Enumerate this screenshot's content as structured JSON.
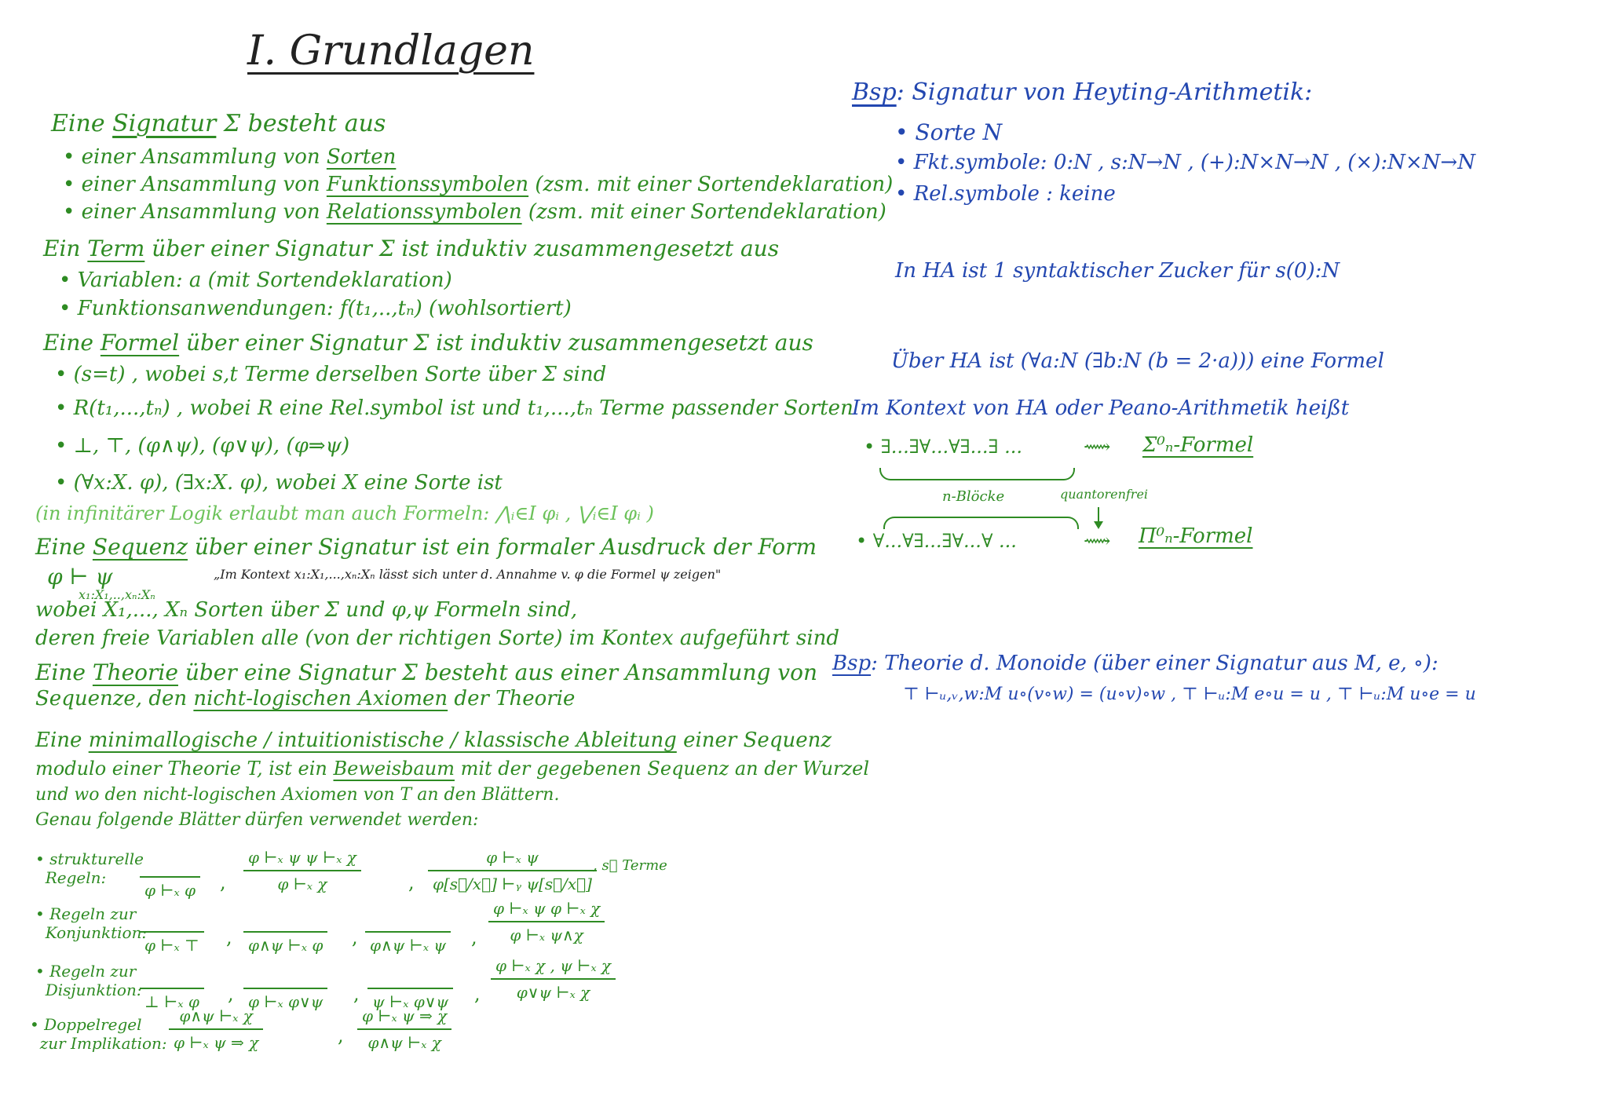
{
  "title": "I. Grundlagen",
  "left": {
    "signatur_intro": {
      "pre": "Eine ",
      "term": "Signatur",
      "post": " Σ besteht aus"
    },
    "signatur_items": [
      {
        "pre": "• einer Ansammlung von ",
        "term": "Sorten",
        "post": ""
      },
      {
        "pre": "• einer Ansammlung von ",
        "term": "Funktionssymbolen",
        "post": " (zsm. mit einer Sortendeklaration)"
      },
      {
        "pre": "• einer Ansammlung von ",
        "term": "Relationssymbolen",
        "post": " (zsm. mit einer Sortendeklaration)"
      }
    ],
    "term_intro": {
      "pre": "Ein ",
      "term": "Term",
      "post": " über einer Signatur Σ ist induktiv zusammengesetzt aus"
    },
    "term_items": [
      "• Variablen: a   (mit Sortendeklaration)",
      "• Funktionsanwendungen: f(t₁,..,tₙ)   (wohlsortiert)"
    ],
    "formel_intro": {
      "pre": "Eine ",
      "term": "Formel",
      "post": " über einer Signatur Σ ist induktiv zusammengesetzt aus"
    },
    "formel_items": [
      "• (s=t)  , wobei  s,t  Terme derselben Sorte über Σ sind",
      "• R(t₁,...,tₙ) , wobei R eine Rel.symbol ist und t₁,...,tₙ Terme passender Sorten",
      "• ⊥, ⊤, (φ∧ψ), (φ∨ψ), (φ⇒ψ)",
      "• (∀x:X. φ), (∃x:X. φ), wobei X eine Sorte ist"
    ],
    "infinitary_note": "(in infinitärer Logik erlaubt man auch Formeln: ⋀ᵢ∈I φᵢ , ⋁ᵢ∈I φᵢ )",
    "sequenz_intro": {
      "pre": "Eine ",
      "term": "Sequenz",
      "post": " über einer Signatur ist ein formaler Ausdruck der Form"
    },
    "sequenz_form": "φ ⊢ ψ",
    "sequenz_subscript": "x₁:X₁,..,xₙ:Xₙ",
    "sequenz_reading": "„Im Kontext x₁:X₁,...,xₙ:Xₙ lässt sich unter d. Annahme v. φ die Formel ψ zeigen\"",
    "sequenz_where": [
      "wobei X₁,..., Xₙ Sorten über Σ und φ,ψ Formeln sind,",
      "deren freie Variablen alle (von der richtigen Sorte) im Kontex aufgeführt sind"
    ],
    "theorie_intro": {
      "pre": "Eine ",
      "term": "Theorie",
      "post": " über eine Signatur Σ besteht aus einer Ansammlung von"
    },
    "theorie_line2": {
      "pre": "Sequenze, den ",
      "term": "nicht-logischen Axiomen",
      "post": " der Theorie"
    },
    "ableitung_line1": {
      "pre": "Eine ",
      "term": "minimallogische / intuitionistische / klassische Ableitung",
      "post": " einer Sequenz"
    },
    "ableitung_line2": {
      "pre": "modulo einer Theorie T, ist ein ",
      "term": "Beweisbaum",
      "post": " mit der gegebenen Sequenz an der Wurzel"
    },
    "ableitung_line3": "und wo den nicht-logischen Axiomen von T an den Blättern.",
    "ableitung_line4": "Genau folgende Blätter dürfen verwendet werden:",
    "rules": {
      "struct_label": "• strukturelle\n  Regeln:",
      "struct": [
        {
          "num": "",
          "den": "φ ⊢ₓ φ"
        },
        {
          "num": "φ ⊢ₓ ψ    ψ ⊢ₓ χ",
          "den": "φ ⊢ₓ χ"
        },
        {
          "num": "φ ⊢ₓ ψ",
          "den": "φ[s⃗/x⃗] ⊢ᵧ ψ[s⃗/x⃗]"
        }
      ],
      "struct_note": ", s⃗ Terme",
      "konj_label": "• Regeln zur\n  Konjunktion:",
      "konj": [
        {
          "num": "",
          "den": "φ ⊢ₓ ⊤"
        },
        {
          "num": "",
          "den": "φ∧ψ ⊢ₓ φ"
        },
        {
          "num": "",
          "den": "φ∧ψ ⊢ₓ ψ"
        },
        {
          "num": "φ ⊢ₓ ψ    φ ⊢ₓ χ",
          "den": "φ ⊢ₓ ψ∧χ"
        }
      ],
      "disj_label": "• Regeln zur\n  Disjunktion:",
      "disj": [
        {
          "num": "",
          "den": "⊥ ⊢ₓ φ"
        },
        {
          "num": "",
          "den": "φ ⊢ₓ φ∨ψ"
        },
        {
          "num": "",
          "den": "ψ ⊢ₓ φ∨ψ"
        },
        {
          "num": "φ ⊢ₓ χ , ψ ⊢ₓ χ",
          "den": "φ∨ψ ⊢ₓ χ"
        }
      ],
      "impl_label": "• Doppelregel\n  zur Implikation:",
      "impl": [
        {
          "num": "φ∧ψ ⊢ₓ χ",
          "den": "φ ⊢ₓ ψ ⇒ χ"
        },
        {
          "num": "φ ⊢ₓ ψ ⇒ χ",
          "den": "φ∧ψ ⊢ₓ χ"
        }
      ]
    }
  },
  "right": {
    "bsp1_label": "Bsp",
    "bsp1_title": ": Signatur von Heyting-Arithmetik:",
    "bsp1_items": [
      "• Sorte N",
      "• Fkt.symbole: 0:N , s:N→N , (+):N×N→N , (×):N×N→N",
      "• Rel.symbole : keine"
    ],
    "ha_sugar": "In HA ist 1 syntaktischer Zucker für s(0):N",
    "ha_formel": "Über HA ist  (∀a:N (∃b:N (b = 2·a))) eine Formel",
    "kontext_line": "Im Kontext  von HA oder Peano-Arithmetik heißt",
    "sigma_prefix": "• ∃...∃∀...∀∃...∃ ...",
    "sigma_arrow": "⟿",
    "sigma_name": "Σ⁰ₙ-Formel",
    "n_bloecke": "n-Blöcke",
    "quantorenfrei": "quantorenfrei",
    "pi_prefix": "• ∀...∀∃...∃∀...∀ ...",
    "pi_arrow": "⟿",
    "pi_name": "Π⁰ₙ-Formel",
    "bsp2_label": "Bsp",
    "bsp2_title": ": Theorie d. Monoide (über einer Signatur aus M, e, ∘):",
    "bsp2_axioms": "⊤ ⊢ᵤ,ᵥ,w:M u∘(v∘w) = (u∘v)∘w ,  ⊤ ⊢ᵤ:M e∘u = u ,  ⊤ ⊢ᵤ:M u∘e = u"
  },
  "colors": {
    "green": "#2e8b23",
    "blue": "#2347b0",
    "light_green": "#6cc25a",
    "dark": "#222222"
  }
}
